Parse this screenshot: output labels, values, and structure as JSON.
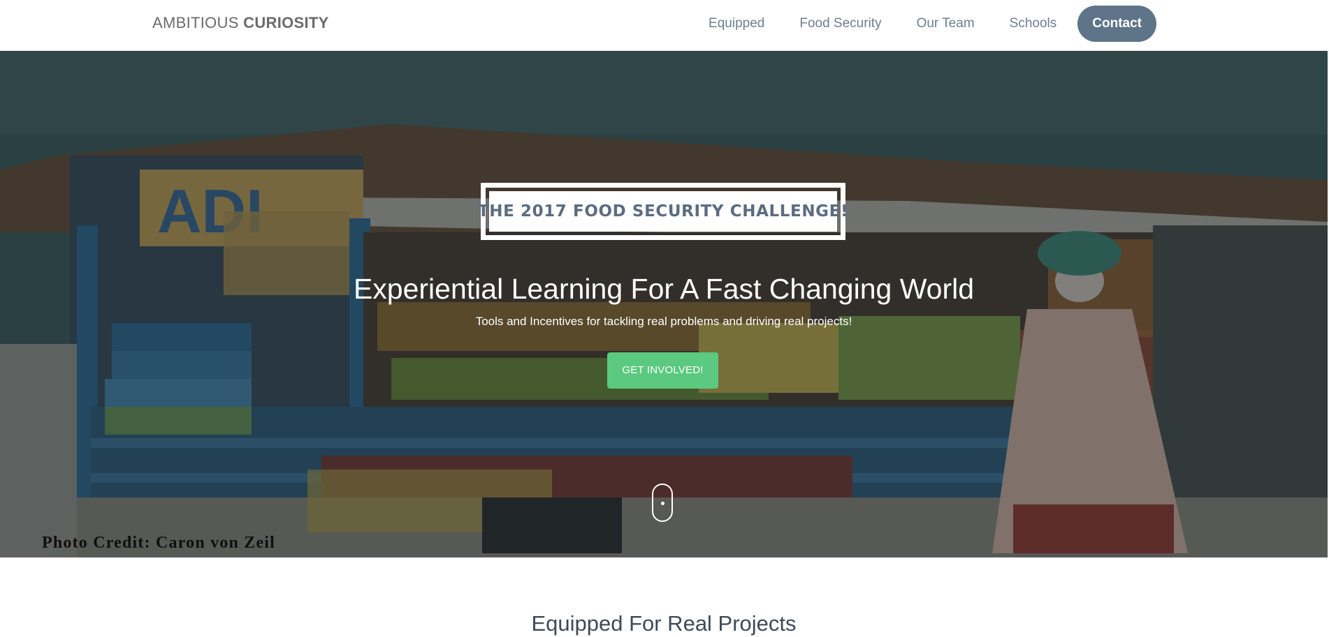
{
  "navbar": {
    "brand_light": "AMBITIOUS",
    "brand_bold": "CURIOSITY",
    "links": [
      {
        "label": "Equipped"
      },
      {
        "label": "Food Security"
      },
      {
        "label": "Our Team"
      },
      {
        "label": "Schools"
      },
      {
        "label": "Contact",
        "active": true
      }
    ]
  },
  "hero": {
    "challenge_label": "THE 2017 FOOD SECURITY CHALLENGE!",
    "title": "Experiential Learning For A Fast Changing World",
    "subtitle": "Tools and Incentives for tackling real problems and driving real projects!",
    "cta_label": "GET INVOLVED!",
    "photo_credit": "Photo Credit: Caron von Zeil",
    "background_description_colors": {
      "sky": "#4a6b6d",
      "stall": "#3f6c8e",
      "overlay": "#1a2428"
    }
  },
  "section": {
    "title": "Equipped For Real Projects"
  },
  "colors": {
    "nav_text": "#6e7f92",
    "nav_active_bg": "#5f7488",
    "cta_green": "#5bc97f",
    "challenge_text": "#5b6c80"
  }
}
